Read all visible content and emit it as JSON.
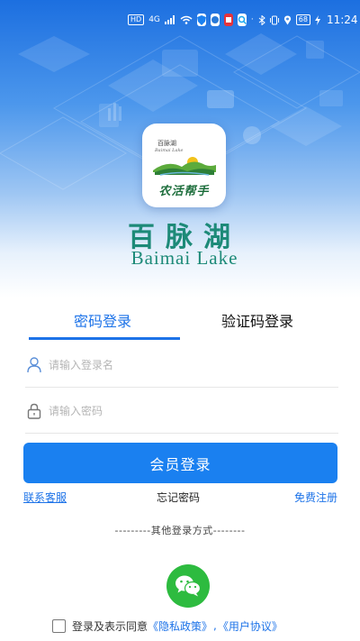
{
  "status_bar": {
    "hd": "HD",
    "net": "4G",
    "wifi": "wifi-icon",
    "time": "11:24",
    "battery": "68"
  },
  "logo": {
    "sub_title": "百脉湖",
    "sub_en": "Baimai Lake",
    "app_name": "农活帮手"
  },
  "brand": {
    "cn": "百脉湖",
    "en": "Baimai Lake"
  },
  "tabs": [
    {
      "label": "密码登录",
      "active": true
    },
    {
      "label": "验证码登录",
      "active": false
    }
  ],
  "form": {
    "username_placeholder": "请输入登录名",
    "password_placeholder": "请输入密码",
    "login_label": "会员登录"
  },
  "links": {
    "service": "联系客服",
    "forgot": "忘记密码",
    "register": "免费注册"
  },
  "other_login": "---------其他登录方式--------",
  "agreement": {
    "prefix": "登录及表示同意",
    "privacy": "《隐私政策》",
    "separator": ",",
    "terms": "《用户协议》"
  },
  "colors": {
    "accent": "#1a80f0",
    "brand": "#1d8a78",
    "wechat": "#2dbb3f"
  }
}
